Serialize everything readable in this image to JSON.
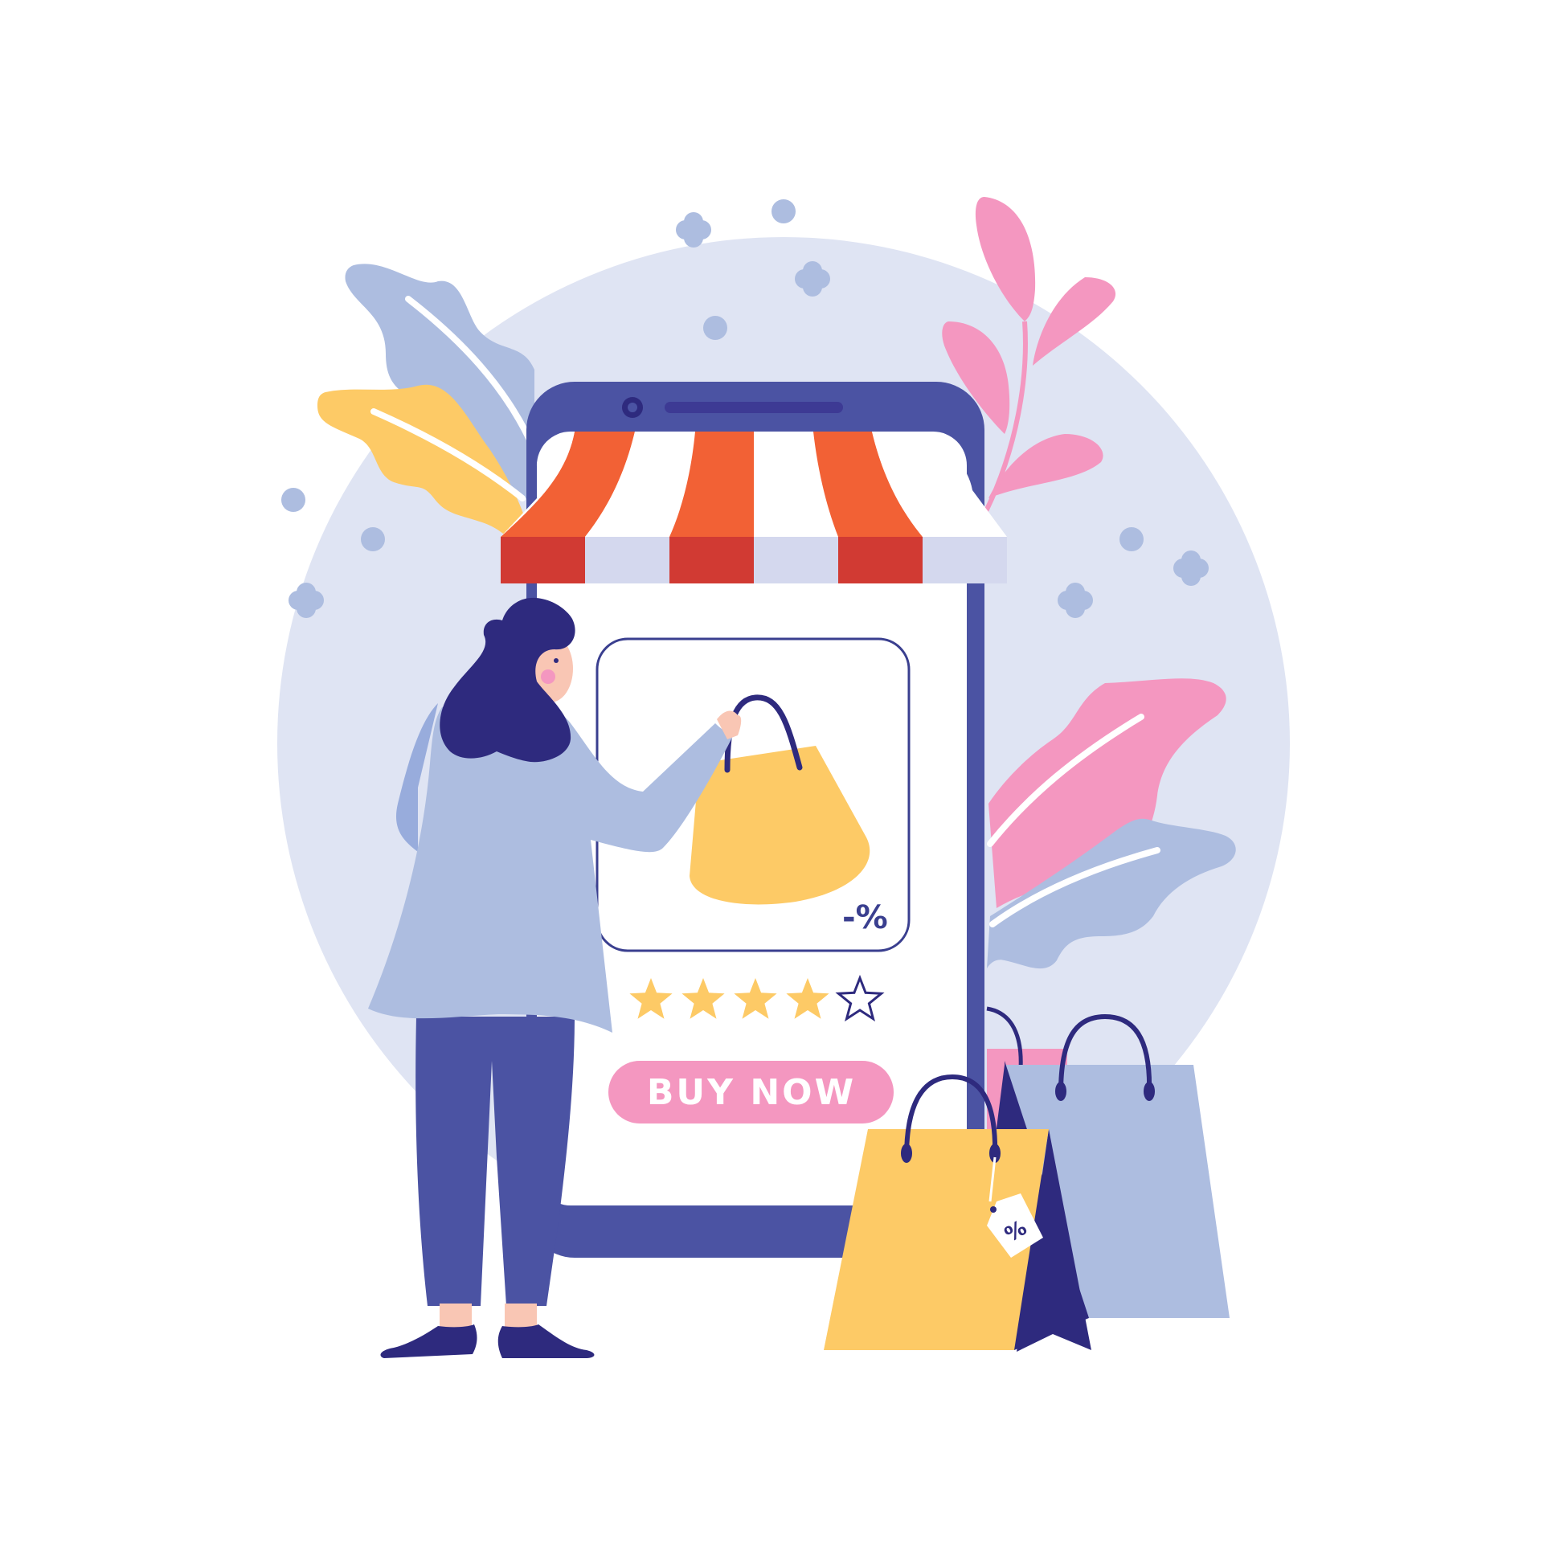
{
  "product_card": {
    "discount_label": "-%",
    "rating": {
      "filled": 4,
      "total": 5
    }
  },
  "buy_button": {
    "label": "BUY NOW"
  },
  "price_tag": {
    "label": "%"
  },
  "colors": {
    "phone": "#4b53a3",
    "awning_orange": "#f26135",
    "awning_red": "#d13a33",
    "awning_light": "#d4d8ee",
    "bag_yellow": "#fdca66",
    "bag_lavender": "#adbde0",
    "bag_navy": "#2e2a7e",
    "button_pink": "#f497c0",
    "backdrop": "#dfe4f3",
    "star_yellow": "#fdca66"
  },
  "icons": {
    "backdrop": "sparkle-cross-icon",
    "foliage": "leaf-icon",
    "star": "star-icon"
  }
}
